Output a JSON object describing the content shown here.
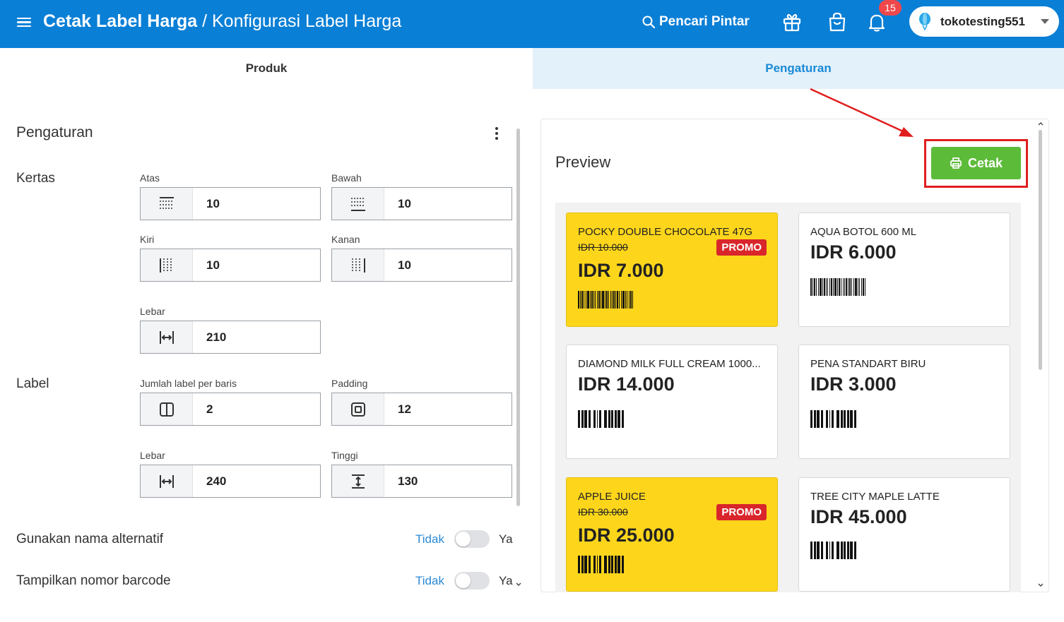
{
  "header": {
    "title_strong": "Cetak Label Harga",
    "separator": "/",
    "title_sub": "Konfigurasi Label Harga",
    "smart_search": "Pencari Pintar",
    "notification_count": "15",
    "store_name": "tokotesting551"
  },
  "tabs": [
    {
      "label": "Produk",
      "active": false
    },
    {
      "label": "Pengaturan",
      "active": true
    }
  ],
  "settings": {
    "title": "Pengaturan",
    "kertas": {
      "label": "Kertas",
      "fields": {
        "atas": {
          "label": "Atas",
          "value": "10"
        },
        "bawah": {
          "label": "Bawah",
          "value": "10"
        },
        "kiri": {
          "label": "Kiri",
          "value": "10"
        },
        "kanan": {
          "label": "Kanan",
          "value": "10"
        },
        "lebar": {
          "label": "Lebar",
          "value": "210"
        }
      }
    },
    "label": {
      "label": "Label",
      "fields": {
        "per_row": {
          "label": "Jumlah label per baris",
          "value": "2"
        },
        "padding": {
          "label": "Padding",
          "value": "12"
        },
        "lebar": {
          "label": "Lebar",
          "value": "240"
        },
        "tinggi": {
          "label": "Tinggi",
          "value": "130"
        }
      }
    },
    "toggles": [
      {
        "label": "Gunakan nama alternatif",
        "off": "Tidak",
        "on": "Ya"
      },
      {
        "label": "Tampilkan nomor barcode",
        "off": "Tidak",
        "on": "Ya"
      }
    ]
  },
  "preview": {
    "title": "Preview",
    "print_button": "Cetak",
    "cards": [
      {
        "name": "POCKY DOUBLE CHOCOLATE 47G",
        "old_price": "IDR 10.000",
        "badge": "PROMO",
        "price": "IDR 7.000"
      },
      {
        "name": "AQUA BOTOL 600 ML",
        "price": "IDR 6.000"
      },
      {
        "name": "DIAMOND MILK FULL CREAM 1000...",
        "price": "IDR 14.000"
      },
      {
        "name": "PENA STANDART BIRU",
        "price": "IDR 3.000"
      },
      {
        "name": "APPLE JUICE",
        "old_price": "IDR 30.000",
        "badge": "PROMO",
        "price": "IDR 25.000"
      },
      {
        "name": "TREE CITY MAPLE LATTE",
        "price": "IDR 45.000"
      }
    ]
  },
  "colors": {
    "header_bg": "#0a7fd6",
    "active_tab_text": "#1a8ad6",
    "promo_card_bg": "#fdd61c",
    "promo_badge": "#d9262b",
    "print_button": "#5dbb3a",
    "annotation": "#e01e1e"
  }
}
